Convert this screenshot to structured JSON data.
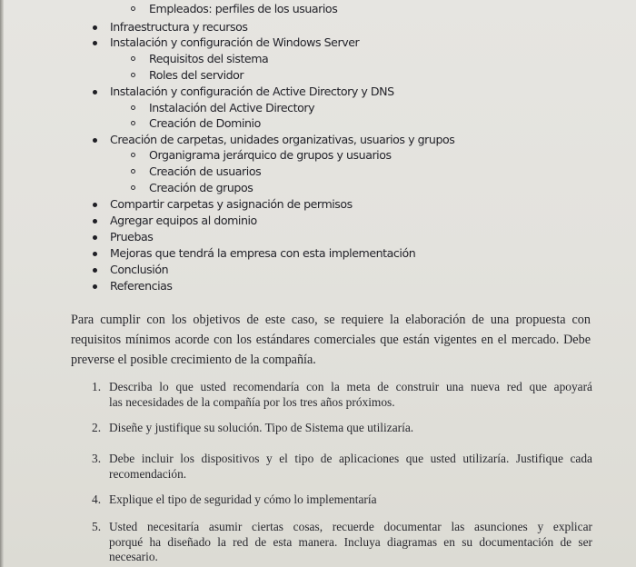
{
  "outline": {
    "items": [
      {
        "level": 2,
        "text": "Empleados: perfiles de los usuarios"
      },
      {
        "level": 1,
        "text": "Infraestructura y recursos"
      },
      {
        "level": 1,
        "text": "Instalación y configuración de Windows Server"
      },
      {
        "level": 2,
        "text": "Requisitos del sistema"
      },
      {
        "level": 2,
        "text": "Roles del servidor"
      },
      {
        "level": 1,
        "text": "Instalación y configuración de Active Directory y DNS"
      },
      {
        "level": 2,
        "text": "Instalación del Active Directory"
      },
      {
        "level": 2,
        "text": "Creación de Dominio"
      },
      {
        "level": 1,
        "text": "Creación de carpetas, unidades organizativas, usuarios y grupos"
      },
      {
        "level": 2,
        "text": "Organigrama jerárquico de grupos y usuarios"
      },
      {
        "level": 2,
        "text": "Creación de usuarios"
      },
      {
        "level": 2,
        "text": "Creación de grupos"
      },
      {
        "level": 1,
        "text": "Compartir carpetas y asignación de permisos"
      },
      {
        "level": 1,
        "text": "Agregar equipos al dominio"
      },
      {
        "level": 1,
        "text": "Pruebas"
      },
      {
        "level": 1,
        "text": "Mejoras que tendrá la empresa con esta implementación"
      },
      {
        "level": 1,
        "text": "Conclusión"
      },
      {
        "level": 1,
        "text": "Referencias"
      }
    ]
  },
  "paragraph": {
    "lines": [
      "Para cumplir con los objetivos de este caso, se requiere la elaboración de una propuesta con",
      "requisitos mínimos acorde con los estándares comerciales que están vigentes en el mercado. Debe",
      "preverse el posible crecimiento de la compañía."
    ]
  },
  "numbered": {
    "items": [
      {
        "marker": "1.",
        "lines": [
          "Describa lo que usted recomendaría con la meta de construir una nueva red que apoyará",
          "las necesidades de la compañía por los tres años próximos."
        ]
      },
      {
        "marker": "2.",
        "lines": [
          "Diseñe y justifique su solución. Tipo de Sistema que utilizaría."
        ]
      },
      {
        "marker": "3.",
        "lines": [
          "Debe incluir los dispositivos y el tipo de aplicaciones que usted utilizaría. Justifique cada",
          "recomendación."
        ]
      },
      {
        "marker": "4.",
        "lines": [
          "Explique el tipo de seguridad y cómo lo implementaría"
        ]
      },
      {
        "marker": "5.",
        "lines": [
          "Usted necesitaría asumir ciertas cosas, recuerde documentar las asunciones y explicar",
          "porqué ha diseñado la red de esta manera. Incluya diagramas en su documentación de ser",
          "necesario."
        ]
      }
    ]
  }
}
